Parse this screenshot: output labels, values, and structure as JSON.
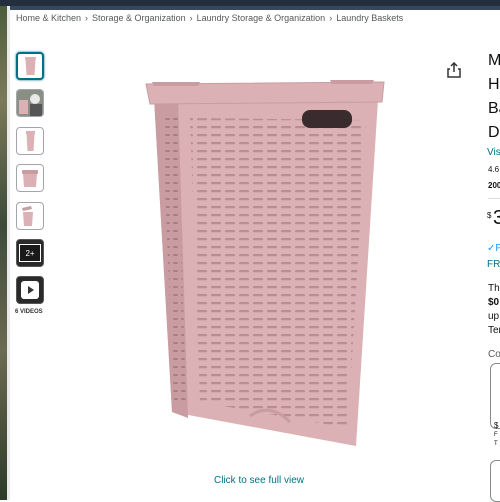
{
  "breadcrumb": {
    "items": [
      "Home & Kitchen",
      "Storage & Organization",
      "Laundry Storage & Organization",
      "Laundry Baskets"
    ],
    "separator": "›"
  },
  "gallery": {
    "more_count_label": "2+",
    "videos_label": "6 VIDEOS",
    "full_view_label": "Click to see full view"
  },
  "product": {
    "title_lines": [
      "M",
      "H",
      "Ba",
      "D"
    ],
    "store_link": "Vis",
    "rating": "4.6",
    "bought": "200",
    "price_symbol": "$",
    "price_whole": "3",
    "prime_label": "✓P",
    "free_label": "FR",
    "promo_lines": [
      "Th",
      "$0",
      "up",
      "Ter"
    ],
    "configuration_label": "Co",
    "option_price": "$",
    "option_sub1": "F",
    "option_sub2": "T"
  },
  "colors": {
    "basket": "#dbb1b5",
    "basket_shadow": "#c99ca1",
    "link": "#007185",
    "active_thumb_border": "#007185"
  }
}
